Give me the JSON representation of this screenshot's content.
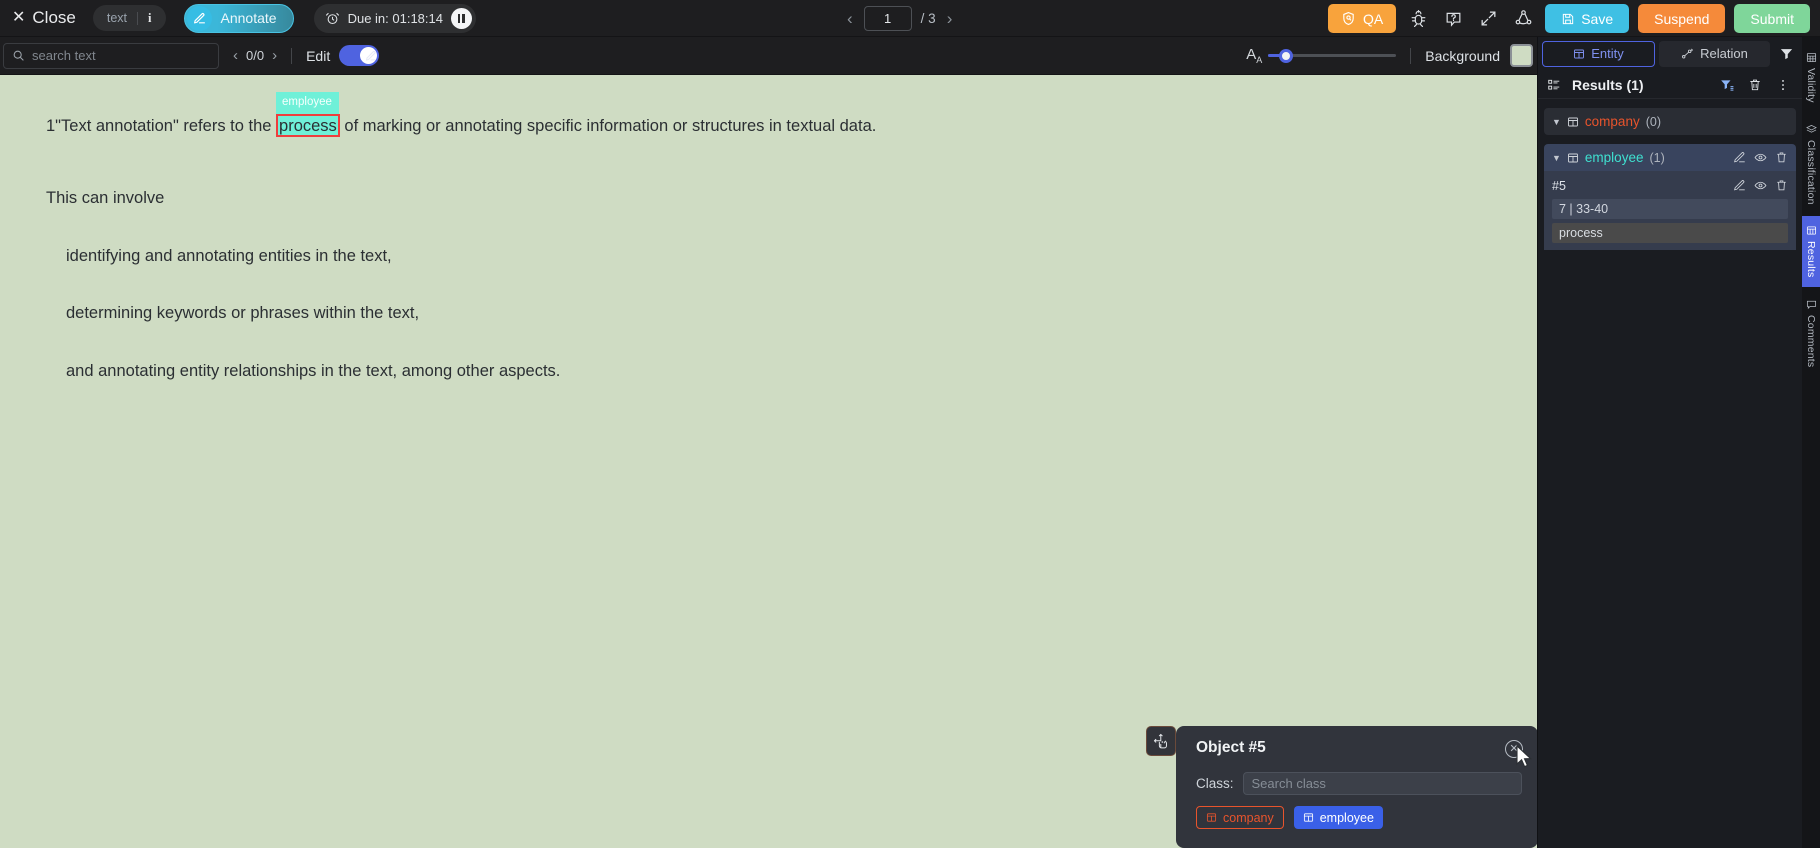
{
  "topbar": {
    "close_label": "Close",
    "close_icon": "close-x-icon",
    "doc_type_label": "text",
    "info_icon_label": "i",
    "annotate_label": "Annotate",
    "annotate_icon": "pencil-icon",
    "due_label": "Due in: 01:18:14",
    "timer_icon": "alarm-clock-icon",
    "pause_icon": "pause-icon",
    "pager": {
      "prev_icon": "chevron-left-icon",
      "current": "1",
      "total": "/ 3",
      "next_icon": "chevron-right-icon"
    },
    "qa_label": "QA",
    "qa_icon": "shield-check-icon",
    "bug_icon": "bug-icon",
    "help_icon": "question-mark-icon",
    "fullscreen_icon": "expand-icon",
    "relation_graph_icon": "relation-graph-icon",
    "save_label": "Save",
    "save_icon": "floppy-disk-icon",
    "suspend_label": "Suspend",
    "submit_label": "Submit"
  },
  "subbar": {
    "search_placeholder": "search text",
    "search_value": "",
    "search_icon": "search-icon",
    "match_count": "0/0",
    "match_prev_icon": "chevron-left-icon",
    "match_next_icon": "chevron-right-icon",
    "edit_label": "Edit",
    "edit_toggle_on": true,
    "font_size_icon": "font-size-icon",
    "background_label": "Background",
    "background_color": "#cfdcc3"
  },
  "document": {
    "background_color": "#cfdcc3",
    "lines": [
      {
        "prefix": "1\"Text annotation\" refers to the ",
        "highlight": "process",
        "suffix": " of marking or annotating specific information or structures in textual data.",
        "tag": "employee"
      },
      {
        "text": "This can involve"
      },
      {
        "text": "identifying and annotating entities in the text,"
      },
      {
        "text": "determining keywords or phrases within the text,"
      },
      {
        "text": "and annotating entity relationships in the text, among other aspects."
      }
    ],
    "highlight_color": "#6ff0d8",
    "highlight_border_color": "#ef3d3d"
  },
  "popup": {
    "drag_icon": "drag-move-icon",
    "title": "Object #5",
    "close_icon": "close-circle-icon",
    "class_label": "Class:",
    "class_placeholder": "Search class",
    "class_value": "",
    "options": [
      {
        "label": "company",
        "icon": "entity-icon",
        "color": "#e8542c",
        "selected": false
      },
      {
        "label": "employee",
        "icon": "entity-icon",
        "color": "#3a60e8",
        "selected": true
      }
    ]
  },
  "right_panel": {
    "tabs": [
      {
        "label": "Entity",
        "icon": "entity-icon",
        "active": true
      },
      {
        "label": "Relation",
        "icon": "relation-icon",
        "active": false
      }
    ],
    "filter_icon": "filter-icon",
    "results_title": "Results (1)",
    "results_icon": "list-icon",
    "results_filter_icon": "filter-list-icon",
    "results_delete_icon": "trash-icon",
    "results_more_icon": "more-vertical-icon",
    "groups": [
      {
        "name": "company",
        "count": "(0)",
        "color": "#e8542c",
        "icon": "entity-icon",
        "caret_icon": "caret-down-icon",
        "expanded": true,
        "objects": []
      },
      {
        "name": "employee",
        "count": "(1)",
        "color": "#3fe0d0",
        "icon": "entity-icon",
        "caret_icon": "caret-down-icon",
        "expanded": true,
        "edit_icon": "pencil-icon",
        "eye_icon": "eye-icon",
        "trash_icon": "trash-icon",
        "objects": [
          {
            "id": "#5",
            "meta": "7 | 33-40",
            "value": "process",
            "edit_icon": "pencil-icon",
            "eye_icon": "eye-icon",
            "trash_icon": "trash-icon"
          }
        ]
      }
    ]
  },
  "vertical_tabs": [
    {
      "label": "Validity",
      "icon": "validity-icon",
      "active": false
    },
    {
      "label": "Classification",
      "icon": "classification-icon",
      "active": false
    },
    {
      "label": "Results",
      "icon": "results-icon",
      "active": true
    },
    {
      "label": "Comments",
      "icon": "comments-icon",
      "active": false
    }
  ]
}
